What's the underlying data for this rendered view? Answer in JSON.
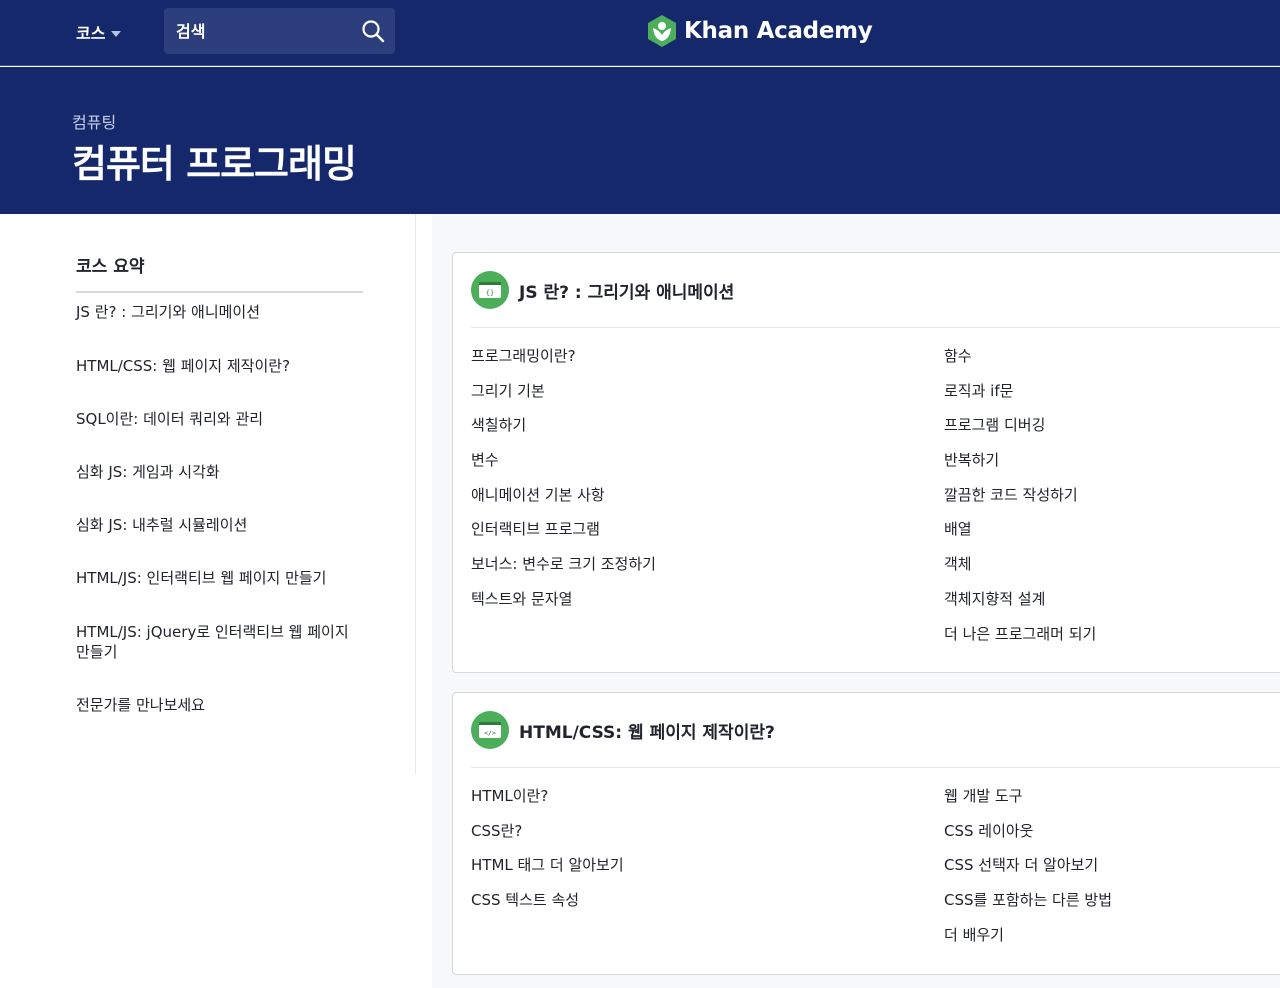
{
  "nav": {
    "courses_label": "코스",
    "search_placeholder": "검색",
    "logo_text": "Khan Academy"
  },
  "hero": {
    "subtitle": "컴퓨팅",
    "title": "컴퓨터 프로그래밍"
  },
  "sidebar": {
    "heading": "코스 요약",
    "items": [
      "JS 란? : 그리기와 애니메이션",
      "HTML/CSS: 웹 페이지 제작이란?",
      "SQL이란: 데이터 쿼리와 관리",
      "심화 JS: 게임과 시각화",
      "심화 JS: 내추럴 시뮬레이션",
      "HTML/JS: 인터랙티브 웹 페이지 만들기",
      "HTML/JS: jQuery로 인터랙티브 웹 페이지 만들기",
      "전문가를 만나보세요"
    ]
  },
  "units": [
    {
      "title": "JS 란? : 그리기와 애니메이션",
      "icon": "code-braces-icon",
      "left": [
        "프로그래밍이란?",
        "그리기 기본",
        "색칠하기",
        "변수",
        "애니메이션 기본 사항",
        "인터랙티브 프로그램",
        "보너스: 변수로 크기 조정하기",
        "텍스트와 문자열"
      ],
      "right": [
        "함수",
        "로직과 if문",
        "프로그램 디버깅",
        "반복하기",
        "깔끔한 코드 작성하기",
        "배열",
        "객체",
        "객체지향적 설계",
        "더 나은 프로그래머 되기"
      ]
    },
    {
      "title": "HTML/CSS: 웹 페이지 제작이란?",
      "icon": "code-tag-icon",
      "left": [
        "HTML이란?",
        "CSS란?",
        "HTML 태그 더 알아보기",
        "CSS 텍스트 속성"
      ],
      "right": [
        "웹 개발 도구",
        "CSS 레이아웃",
        "CSS 선택자 더 알아보기",
        "CSS를 포함하는 다른 방법",
        "더 배우기"
      ]
    }
  ],
  "colors": {
    "nav_bg": "#14286b",
    "accent_green": "#4cae5b",
    "page_bg": "#f7f8fa"
  }
}
